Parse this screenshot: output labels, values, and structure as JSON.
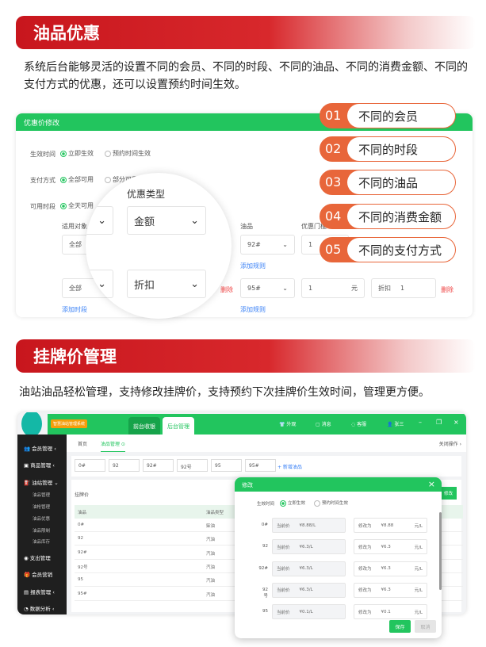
{
  "section1": {
    "title": "油品优惠",
    "description": "系统后台能够灵活的设置不同的会员、不同的时段、不同的油品、不同的消费金额、不同的支付方式的优惠，还可以设置预约时间生效。"
  },
  "discount_panel": {
    "title": "优惠价修改",
    "effective_time": {
      "label": "生效时间",
      "options": [
        "立即生效",
        "预约时间生效"
      ],
      "selected": "立即生效"
    },
    "payment": {
      "label": "支付方式",
      "options": [
        "全部可用",
        "部分可用"
      ],
      "selected": "全部可用"
    },
    "period": {
      "label": "可用时段",
      "options": [
        "全天可用"
      ],
      "selected": "全天可用"
    },
    "columns": {
      "target": "适用对象",
      "oil": "油品",
      "threshold": "优惠门槛",
      "discount_type": "优惠类型"
    },
    "rows": [
      {
        "target": "全部",
        "discount_type": "金额",
        "oil": "92#",
        "threshold": "1"
      },
      {
        "target": "全部",
        "discount_type": "折扣",
        "oil": "95#",
        "threshold": "1",
        "unit": "元",
        "discount_label": "折扣",
        "discount_value": "1"
      }
    ],
    "delete": "删除",
    "add_rule": "添加规则",
    "add_period": "添加时段"
  },
  "badges": [
    {
      "num": "01",
      "text": "不同的会员"
    },
    {
      "num": "02",
      "text": "不同的时段"
    },
    {
      "num": "03",
      "text": "不同的油品"
    },
    {
      "num": "04",
      "text": "不同的消费金额"
    },
    {
      "num": "05",
      "text": "不同的支付方式"
    }
  ],
  "section2": {
    "title": "挂牌价管理",
    "description": "油站油品轻松管理，支持修改挂牌价，支持预约下次挂牌价生效时间，管理更方便。"
  },
  "app": {
    "system_name": "智慧油站管理系统",
    "tabs": [
      "前台收银",
      "后台管理"
    ],
    "active_tab": "后台管理",
    "top_actions": [
      "外观",
      "消息",
      "客服",
      "张三"
    ],
    "sidebar": [
      {
        "label": "会员管理"
      },
      {
        "label": "商品管理"
      },
      {
        "label": "油站管理",
        "children": [
          "油品管理",
          "油枪管理",
          "油品优惠",
          "油品限制",
          "油品库存"
        ]
      },
      {
        "label": "支出管理"
      },
      {
        "label": "会员营销"
      },
      {
        "label": "报表管理"
      },
      {
        "label": "数据分析"
      }
    ],
    "page_tabs": [
      "首页",
      "油品管理"
    ],
    "close_ops": "关闭操作",
    "oil_chips": [
      "0#",
      "92",
      "92#",
      "92号",
      "95",
      "95#"
    ],
    "add_oil": "+ 新增油品",
    "table_title": "挂牌价",
    "edit_button": "修改",
    "table_headers": [
      "油品",
      "油品类型"
    ],
    "table_rows": [
      [
        "0#",
        "柴油"
      ],
      [
        "92",
        "汽油"
      ],
      [
        "92#",
        "汽油"
      ],
      [
        "92号",
        "汽油"
      ],
      [
        "95",
        "汽油"
      ],
      [
        "95#",
        "汽油"
      ]
    ],
    "modal": {
      "title": "修改",
      "effective_label": "生效时间",
      "options": [
        "立即生效",
        "预约时间生效"
      ],
      "selected": "立即生效",
      "current_label": "当前价",
      "new_label": "修改为",
      "unit": "元/L",
      "rows": [
        {
          "oil": "0#",
          "current": "¥8.88/L",
          "new": "¥8.88"
        },
        {
          "oil": "92",
          "current": "¥6.3/L",
          "new": "¥6.3"
        },
        {
          "oil": "92#",
          "current": "¥6.3/L",
          "new": "¥6.3"
        },
        {
          "oil": "92号",
          "current": "¥6.3/L",
          "new": "¥6.3"
        },
        {
          "oil": "95",
          "current": "¥0.1/L",
          "new": "¥0.1"
        }
      ],
      "save": "保存",
      "cancel": "取消"
    }
  },
  "colors": {
    "green": "#22c55e",
    "red": "#c8161d",
    "orange": "#e8663a",
    "sidebar": "#1f1f1f"
  }
}
